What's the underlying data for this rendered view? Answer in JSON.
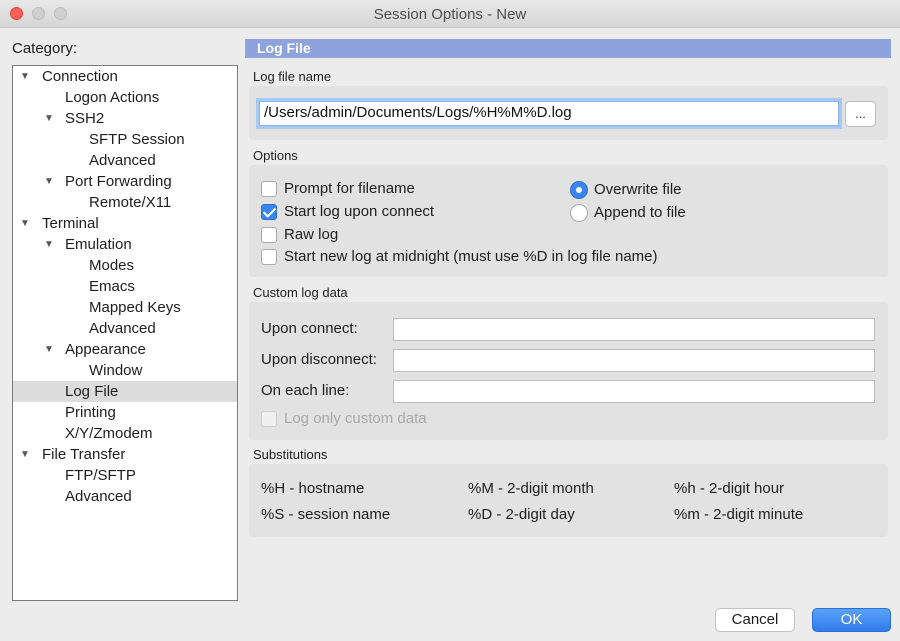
{
  "window": {
    "title": "Session Options - New"
  },
  "category": {
    "label": "Category:",
    "items": [
      {
        "label": "Connection",
        "expanded": true
      },
      {
        "label": "Logon Actions"
      },
      {
        "label": "SSH2",
        "expanded": true
      },
      {
        "label": "SFTP Session"
      },
      {
        "label": "Advanced"
      },
      {
        "label": "Port Forwarding",
        "expanded": true
      },
      {
        "label": "Remote/X11"
      },
      {
        "label": "Terminal",
        "expanded": true
      },
      {
        "label": "Emulation",
        "expanded": true
      },
      {
        "label": "Modes"
      },
      {
        "label": "Emacs"
      },
      {
        "label": "Mapped Keys"
      },
      {
        "label": "Advanced"
      },
      {
        "label": "Appearance",
        "expanded": true
      },
      {
        "label": "Window"
      },
      {
        "label": "Log File",
        "selected": true
      },
      {
        "label": "Printing"
      },
      {
        "label": "X/Y/Zmodem"
      },
      {
        "label": "File Transfer",
        "expanded": true
      },
      {
        "label": "FTP/SFTP"
      },
      {
        "label": "Advanced"
      }
    ]
  },
  "panel": {
    "header": "Log File",
    "log_file_name": {
      "label": "Log file name",
      "value": "/Users/admin/Documents/Logs/%H%M%D.log",
      "browse_label": "..."
    },
    "options": {
      "label": "Options",
      "checkboxes": [
        {
          "label": "Prompt for filename",
          "checked": false
        },
        {
          "label": "Start log upon connect",
          "checked": true
        },
        {
          "label": "Raw log",
          "checked": false
        },
        {
          "label": "Start new log at midnight (must use %D in log file name)",
          "checked": false
        }
      ],
      "radios": [
        {
          "label": "Overwrite file",
          "selected": true
        },
        {
          "label": "Append to file",
          "selected": false
        }
      ]
    },
    "custom_log_data": {
      "label": "Custom log data",
      "fields": [
        {
          "label": "Upon connect:",
          "value": ""
        },
        {
          "label": "Upon disconnect:",
          "value": ""
        },
        {
          "label": "On each line:",
          "value": ""
        }
      ],
      "log_only_custom": {
        "label": "Log only custom data",
        "checked": false,
        "disabled": true
      }
    },
    "substitutions": {
      "label": "Substitutions",
      "items": [
        "%H - hostname",
        "%M - 2-digit month",
        "%h - 2-digit hour",
        "%S - session name",
        "%D - 2-digit day",
        "%m - 2-digit minute"
      ]
    }
  },
  "buttons": {
    "cancel": "Cancel",
    "ok": "OK"
  },
  "colors": {
    "accent": "#3a86f0",
    "header_bg": "#8ea2dd",
    "close": "#fe5f57"
  }
}
